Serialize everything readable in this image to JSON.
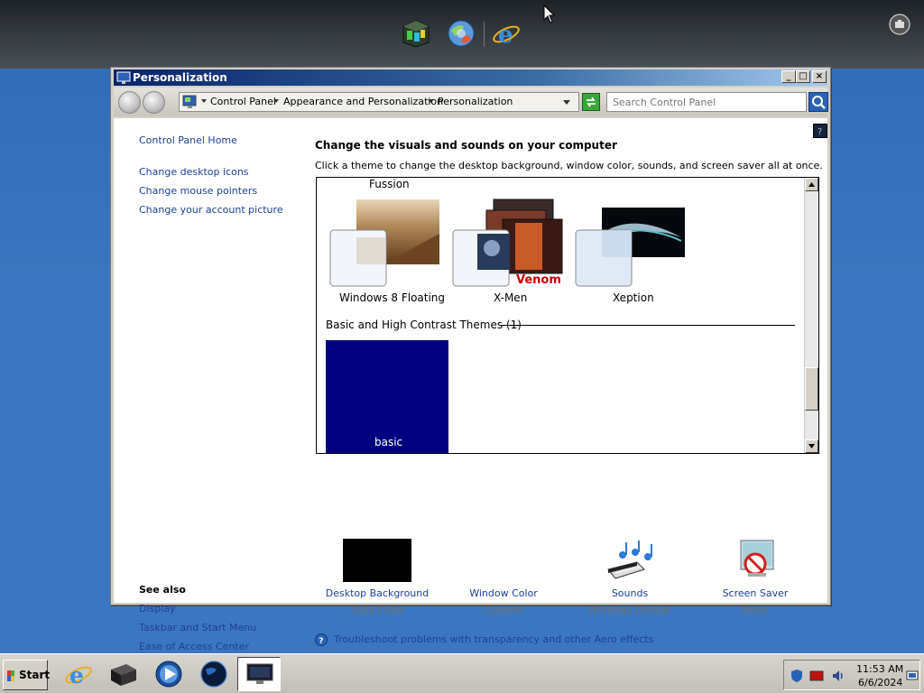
{
  "window": {
    "title": "Personalization",
    "minimize_glyph": "_",
    "maximize_glyph": "□",
    "close_glyph": "×"
  },
  "address_bar": {
    "crumbs": [
      "Control Panel",
      "Appearance and Personalization",
      "Personalization"
    ],
    "search_placeholder": "Search Control Panel"
  },
  "sidebar": {
    "home": "Control Panel Home",
    "links": [
      "Change desktop icons",
      "Change mouse pointers",
      "Change your account picture"
    ],
    "see_also_title": "See also",
    "see_also": [
      "Display",
      "Taskbar and Start Menu",
      "Ease of Access Center"
    ]
  },
  "main": {
    "heading": "Change the visuals and sounds on your computer",
    "subtext": "Click a theme to change the desktop background, window color, sounds, and screen saver all at once.",
    "themes_group_label": "Fussion",
    "themes": [
      {
        "name": "Windows 8 Floating"
      },
      {
        "name": "X-Men"
      },
      {
        "name": "Xeption"
      }
    ],
    "basic_group_label": "Basic and High Contrast Themes (1)",
    "basic_theme": {
      "name": "basic",
      "color": "#000080"
    },
    "venom_text": "Venom",
    "scroll_position": 0.86
  },
  "settings": [
    {
      "label": "Desktop Background",
      "value": "Solid Color",
      "icon": "solid-color-swatch"
    },
    {
      "label": "Window Color",
      "value": "Custom",
      "icon": "window-color-icon"
    },
    {
      "label": "Sounds",
      "value": "Windows Default",
      "icon": "sounds-icon"
    },
    {
      "label": "Screen Saver",
      "value": "None",
      "icon": "screen-saver-icon"
    }
  ],
  "troubleshoot_link": "Troubleshoot problems with transparency and other Aero effects",
  "taskbar": {
    "start_label": "Start",
    "clock_time": "11:53 AM",
    "clock_date": "6/6/2024"
  },
  "colors": {
    "link": "#1f3f99",
    "desktop": "#3b77be",
    "titlebar": "#0a246a"
  }
}
